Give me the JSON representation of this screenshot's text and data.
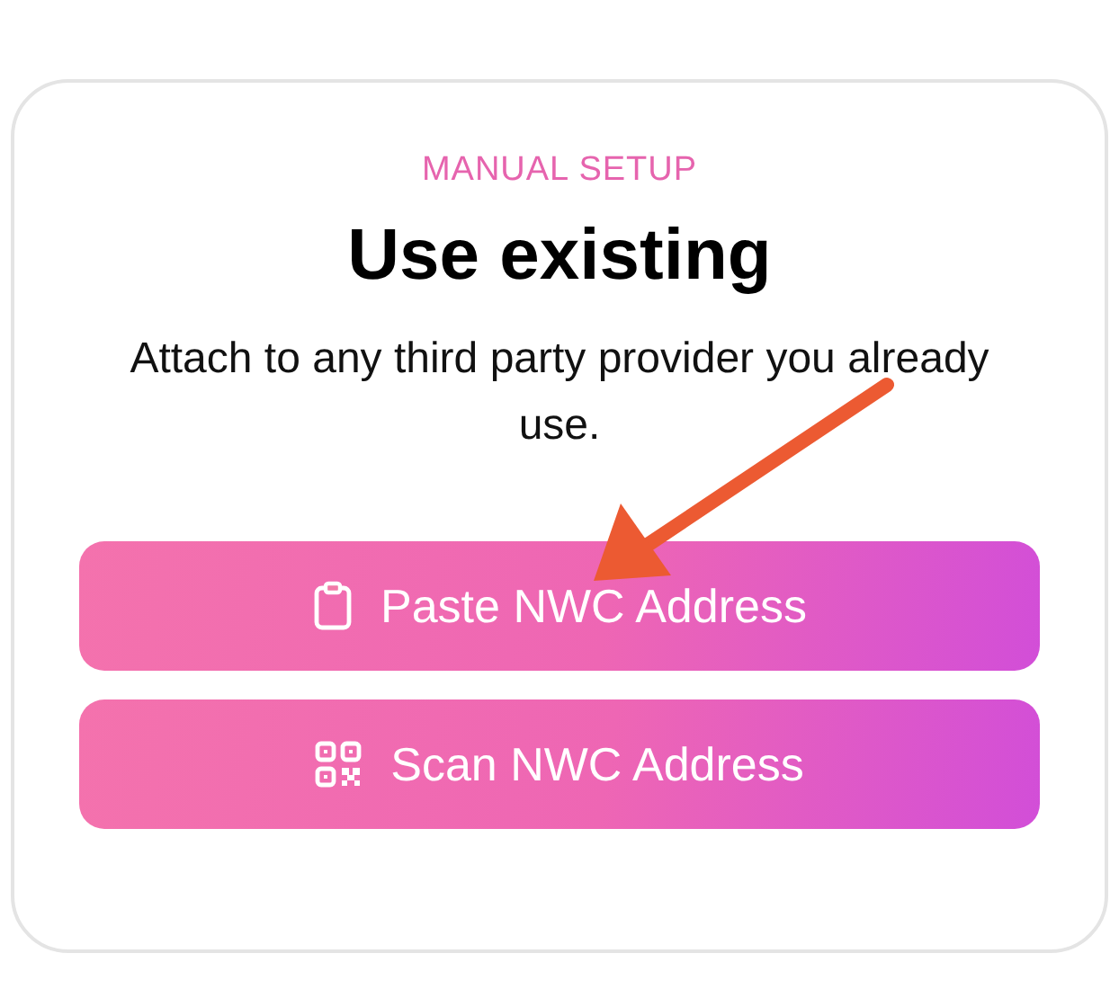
{
  "header": {
    "eyebrow": "MANUAL SETUP",
    "title": "Use existing",
    "description": "Attach to any third party provider you already use."
  },
  "buttons": [
    {
      "kind": "paste",
      "label": "Paste NWC Address"
    },
    {
      "kind": "scan",
      "label": "Scan NWC Address"
    }
  ],
  "annotation": {
    "kind": "arrow"
  }
}
